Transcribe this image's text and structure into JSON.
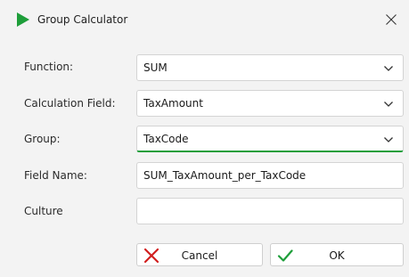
{
  "window": {
    "title": "Group Calculator",
    "icon": "green-play-triangle-icon",
    "accent_color": "#1e9e3a"
  },
  "form": {
    "function": {
      "label": "Function:",
      "value": "SUM"
    },
    "calculation_field": {
      "label": "Calculation Field:",
      "value": "TaxAmount"
    },
    "group": {
      "label": "Group:",
      "value": "TaxCode"
    },
    "field_name": {
      "label": "Field Name:",
      "value": "SUM_TaxAmount_per_TaxCode"
    },
    "culture": {
      "label": "Culture",
      "value": ""
    }
  },
  "buttons": {
    "cancel": {
      "label": "Cancel",
      "icon": "red-x-icon",
      "icon_color": "#d11f1f"
    },
    "ok": {
      "label": "OK",
      "icon": "green-check-icon",
      "icon_color": "#1e9e3a"
    }
  }
}
